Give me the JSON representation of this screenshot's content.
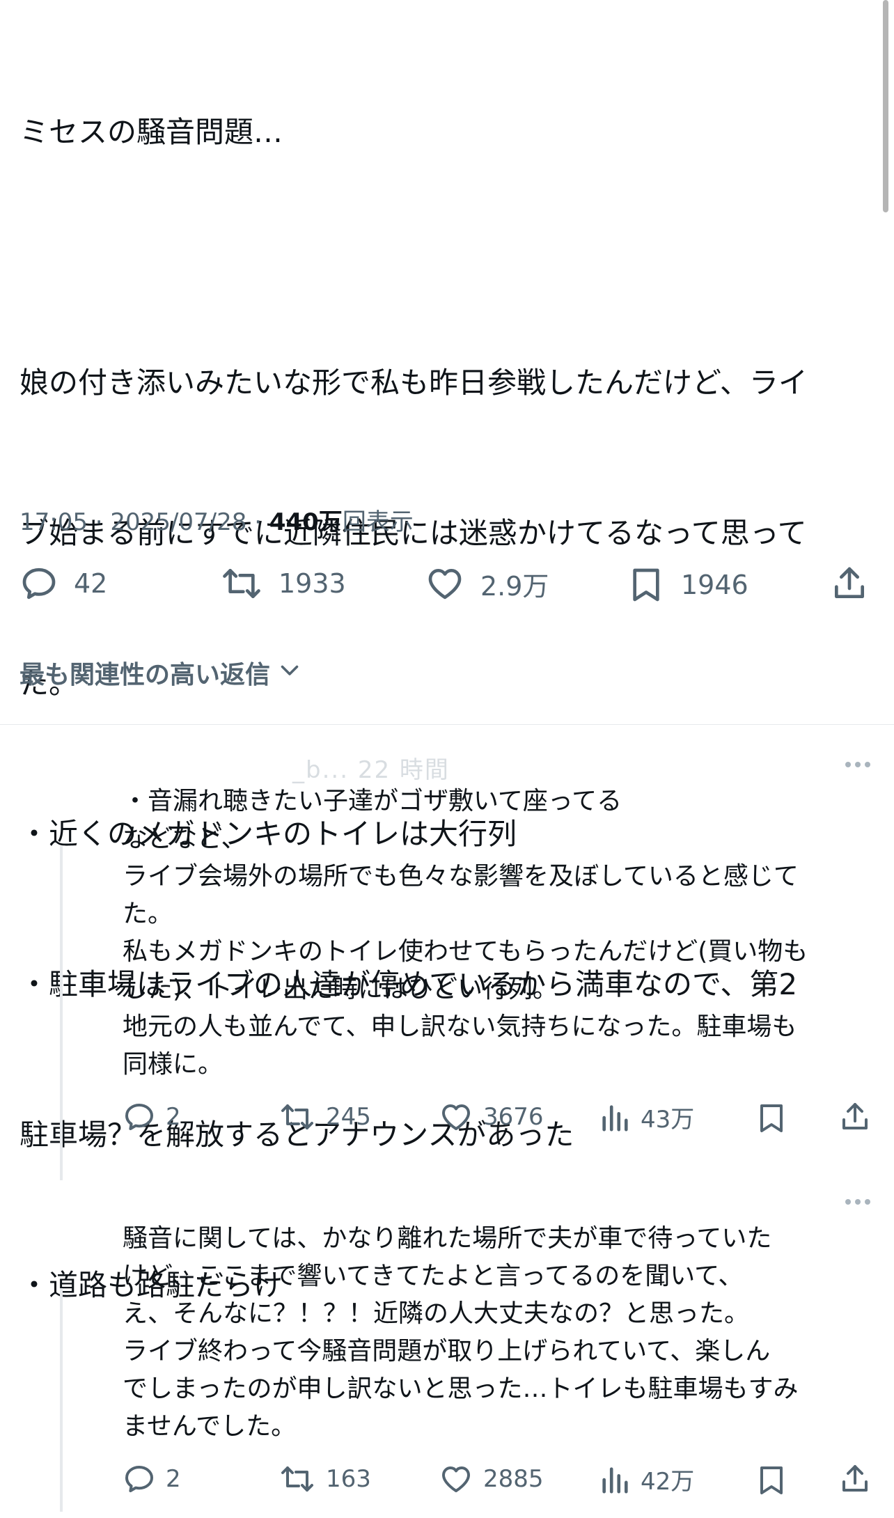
{
  "post": {
    "lines": [
      "ミセスの騒音問題…",
      "",
      "娘の付き添いみたいな形で私も昨日参戦したんだけど、ライ",
      "ブ始まる前にすでに近隣住民には迷惑かけてるなって思って",
      "た。",
      "・近くのメガドンキのトイレは大行列",
      "・駐車場はライブの人達が停めているから満車なので、第2",
      "駐車場？を解放するとアナウンスがあった",
      "・道路も路駐だらけ"
    ],
    "time": "17:05",
    "date": "2025/07/28",
    "views_count": "440万",
    "views_label": "回表示",
    "replies": "42",
    "reposts": "1933",
    "likes": "2.9万",
    "bookmarks": "1946"
  },
  "sort_label": "最も関連性の高い返信",
  "replies": [
    {
      "header": "_b... 22 時間",
      "lines": [
        "・音漏れ聴きたい子達がゴザ敷いて座ってる",
        "などなど、",
        "ライブ会場外の場所でも色々な影響を及ぼしていると感じて",
        "た。",
        "私もメガドンキのトイレ使わせてもらったんだけど(買い物も",
        "した)、トイレ出た時にはひどい行列。",
        "地元の人も並んでて、申し訳ない気持ちになった。駐車場も",
        "同様に。"
      ],
      "replies": "2",
      "reposts": "245",
      "likes": "3676",
      "views": "43万"
    },
    {
      "header": "",
      "lines": [
        "騒音に関しては、かなり離れた場所で夫が車で待っていた",
        "けど、ここまで響いてきてたよと言ってるのを聞いて、",
        "え、そんなに？！？！近隣の人大丈夫なの？と思った。",
        "ライブ終わって今騒音問題が取り上げられていて、楽しん",
        "でしまったのが申し訳ないと思った…トイレも駐車場もすみ",
        "ませんでした。"
      ],
      "replies": "2",
      "reposts": "163",
      "likes": "2885",
      "views": "42万"
    }
  ],
  "icons": [
    "reply-icon",
    "repost-icon",
    "like-icon",
    "bookmark-icon",
    "share-icon",
    "views-icon",
    "chevron-down-icon",
    "more-icon"
  ]
}
